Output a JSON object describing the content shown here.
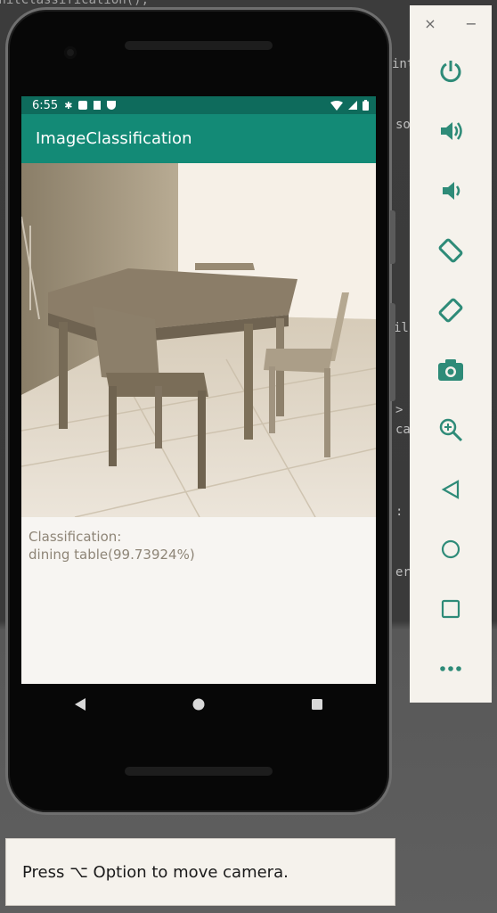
{
  "ide": {
    "code_fragments": [
      "initClassification();",
      "inte",
      "so",
      "il",
      ">",
      "ca",
      ":",
      "er"
    ]
  },
  "status_bar": {
    "time": "6:55",
    "left_icons": [
      "settings-icon",
      "a-icon",
      "sd-card-icon",
      "shield-icon"
    ],
    "right_icons": [
      "wifi-icon",
      "cell-signal-icon",
      "battery-icon"
    ]
  },
  "app": {
    "title": "ImageClassification",
    "image_description": "dining-table-photo",
    "result_label": "Classification:",
    "result_value": "dining table(99.73924%)"
  },
  "nav": {
    "back": "back-icon",
    "home": "home-icon",
    "recents": "recents-icon"
  },
  "toolbar": {
    "close": "×",
    "minimize": "−",
    "items": [
      "power-icon",
      "volume-up-icon",
      "volume-down-icon",
      "rotate-left-icon",
      "rotate-right-icon",
      "camera-icon",
      "zoom-icon",
      "back-icon",
      "home-icon",
      "overview-icon",
      "more-icon"
    ]
  },
  "tooltip": {
    "text": "Press ⌥ Option to move camera."
  },
  "colors": {
    "status_bar": "#0e6b5c",
    "app_bar": "#138a76",
    "accent_icon": "#2e8b78"
  }
}
